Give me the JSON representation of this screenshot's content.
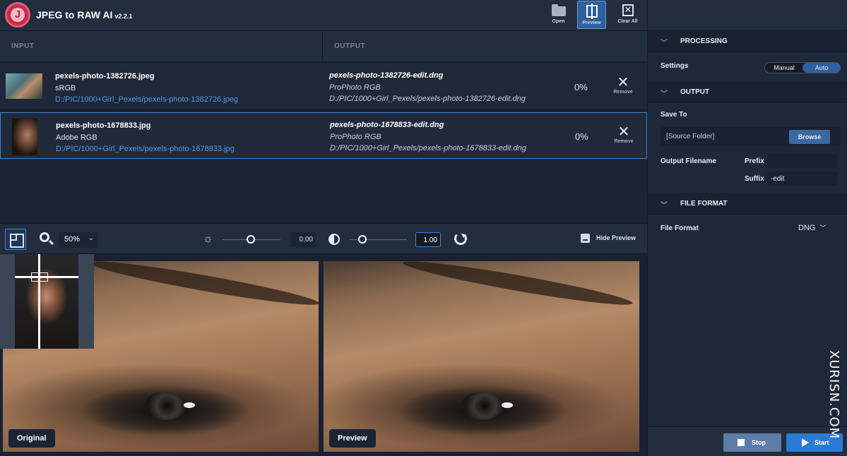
{
  "app": {
    "title": "JPEG to RAW AI",
    "version": "v2.2.1",
    "logo_letter": "J",
    "accent_color": "#3d82d4",
    "brand_color": "#c42e4a"
  },
  "toolbar_top": {
    "open_label": "Open",
    "preview_label": "Preview",
    "clear_all_label": "Clear All"
  },
  "columns": {
    "input": "INPUT",
    "output": "OUTPUT"
  },
  "files": [
    {
      "name": "pexels-photo-1382726.jpeg",
      "colorspace": "sRGB",
      "path": "D:/PIC/1000+Girl_Pexels/pexels-photo-1382726.jpeg",
      "output_name": "pexels-photo-1382726-edit.dng",
      "output_colorspace": "ProPhoto RGB",
      "output_path": "D:/PIC/1000+Girl_Pexels/pexels-photo-1382726-edit.dng",
      "progress": "0%",
      "remove_label": "Remove"
    },
    {
      "name": "pexels-photo-1678833.jpg",
      "colorspace": "Adobe RGB",
      "path": "D:/PIC/1000+Girl_Pexels/pexels-photo-1678833.jpg",
      "output_name": "pexels-photo-1678833-edit.dng",
      "output_colorspace": "ProPhoto RGB",
      "output_path": "D:/PIC/1000+Girl_Pexels/pexels-photo-1678833-edit.dng",
      "progress": "0%",
      "remove_label": "Remove"
    }
  ],
  "view_toolbar": {
    "zoom": "50%",
    "exposure_value": "0.00",
    "contrast_value": "1.00",
    "hide_preview_label": "Hide Preview"
  },
  "preview": {
    "original_label": "Original",
    "preview_label": "Preview"
  },
  "panel": {
    "processing": {
      "header": "PROCESSING",
      "settings_label": "Settings",
      "options": [
        "Manual",
        "Auto"
      ],
      "selected": "Auto"
    },
    "output": {
      "header": "OUTPUT",
      "save_to_label": "Save To",
      "save_to_value": "[Source Folder]",
      "browse_label": "Browse",
      "output_filename_label": "Output Filename",
      "prefix_label": "Prefix",
      "prefix_value": "",
      "suffix_label": "Suffix",
      "suffix_value": "-edit"
    },
    "file_format": {
      "header": "FILE FORMAT",
      "label": "File Format",
      "value": "DNG"
    },
    "actions": {
      "stop_label": "Stop",
      "start_label": "Start"
    }
  },
  "watermark": {
    "text": "XURISN.COM"
  }
}
